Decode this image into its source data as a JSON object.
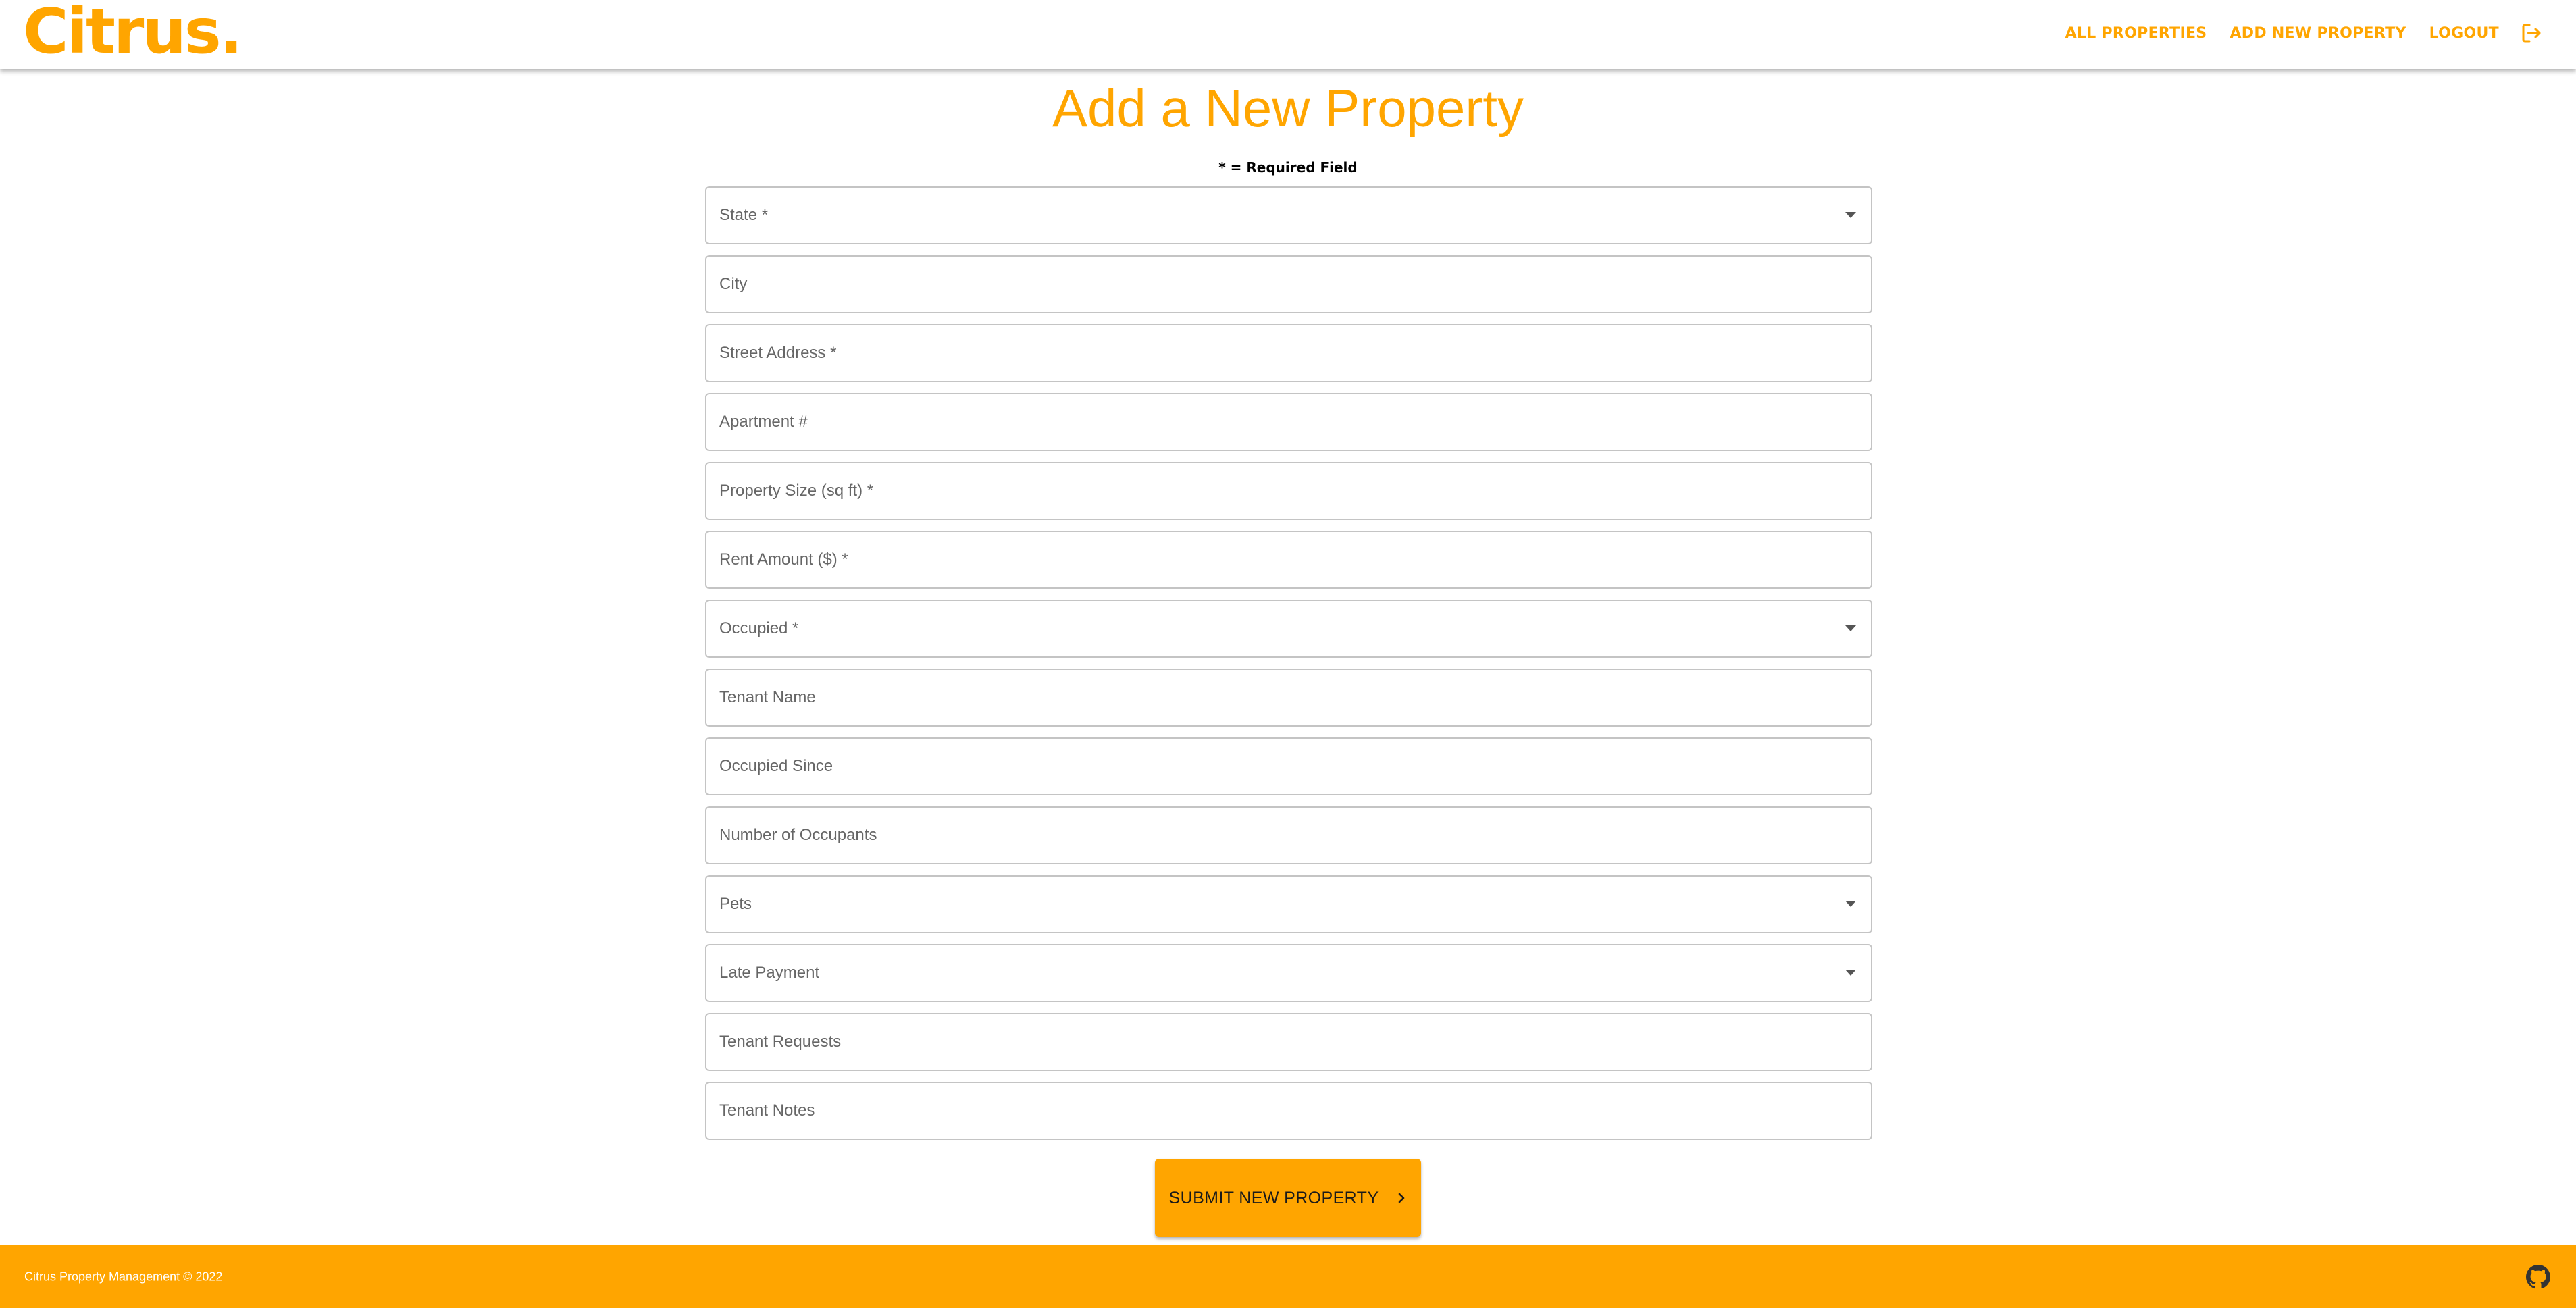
{
  "header": {
    "logo": "Citrus.",
    "nav": {
      "all_properties": "ALL PROPERTIES",
      "add_new_property": "ADD NEW PROPERTY",
      "logout": "LOGOUT"
    },
    "logout_icon": "logout-icon"
  },
  "main": {
    "title": "Add a New Property",
    "required_note": "* = Required Field",
    "fields": [
      {
        "label": "State *",
        "type": "select"
      },
      {
        "label": "City",
        "type": "text"
      },
      {
        "label": "Street Address *",
        "type": "text"
      },
      {
        "label": "Apartment #",
        "type": "text"
      },
      {
        "label": "Property Size (sq ft) *",
        "type": "text"
      },
      {
        "label": "Rent Amount ($) *",
        "type": "text"
      },
      {
        "label": "Occupied *",
        "type": "select"
      },
      {
        "label": "Tenant Name",
        "type": "text"
      },
      {
        "label": "Occupied Since",
        "type": "text"
      },
      {
        "label": "Number of Occupants",
        "type": "text"
      },
      {
        "label": "Pets",
        "type": "select"
      },
      {
        "label": "Late Payment",
        "type": "select"
      },
      {
        "label": "Tenant Requests",
        "type": "text"
      },
      {
        "label": "Tenant Notes",
        "type": "text"
      }
    ],
    "submit_label": "SUBMIT NEW PROPERTY",
    "submit_icon": "chevron-right-icon"
  },
  "footer": {
    "copyright": "Citrus Property Management © 2022",
    "github_icon": "github-icon"
  },
  "colors": {
    "accent": "#ffa500",
    "field_border": "#c4c4c4",
    "label_text": "#666666",
    "footer_text": "#ffffff"
  }
}
